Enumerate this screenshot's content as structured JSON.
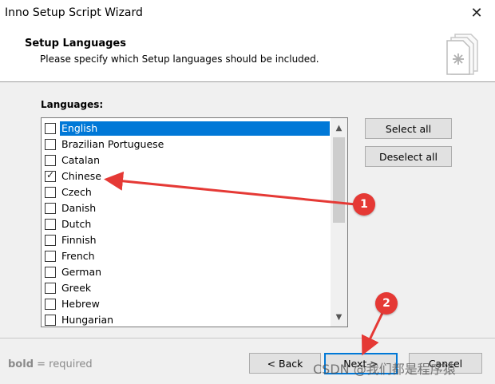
{
  "window": {
    "title": "Inno Setup Script Wizard",
    "close_glyph": "✕"
  },
  "header": {
    "title": "Setup Languages",
    "subtitle": "Please specify which Setup languages should be included."
  },
  "languages_label": "Languages:",
  "languages": [
    {
      "label": "English",
      "checked": false,
      "selected": true
    },
    {
      "label": "Brazilian Portuguese",
      "checked": false,
      "selected": false
    },
    {
      "label": "Catalan",
      "checked": false,
      "selected": false
    },
    {
      "label": "Chinese",
      "checked": true,
      "selected": false
    },
    {
      "label": "Czech",
      "checked": false,
      "selected": false
    },
    {
      "label": "Danish",
      "checked": false,
      "selected": false
    },
    {
      "label": "Dutch",
      "checked": false,
      "selected": false
    },
    {
      "label": "Finnish",
      "checked": false,
      "selected": false
    },
    {
      "label": "French",
      "checked": false,
      "selected": false
    },
    {
      "label": "German",
      "checked": false,
      "selected": false
    },
    {
      "label": "Greek",
      "checked": false,
      "selected": false
    },
    {
      "label": "Hebrew",
      "checked": false,
      "selected": false
    },
    {
      "label": "Hungarian",
      "checked": false,
      "selected": false
    }
  ],
  "buttons": {
    "select_all": "Select all",
    "deselect_all": "Deselect all",
    "back": "< Back",
    "next": "Next >",
    "cancel": "Cancel"
  },
  "footer": {
    "bold_word": "bold",
    "hint_rest": " = required"
  },
  "annotations": {
    "marker1": "1",
    "marker2": "2",
    "color": "#e53935"
  },
  "watermark": "CSDN @我们都是程序猿",
  "colors": {
    "selection": "#0078d7",
    "default_button_border": "#0078d7"
  }
}
